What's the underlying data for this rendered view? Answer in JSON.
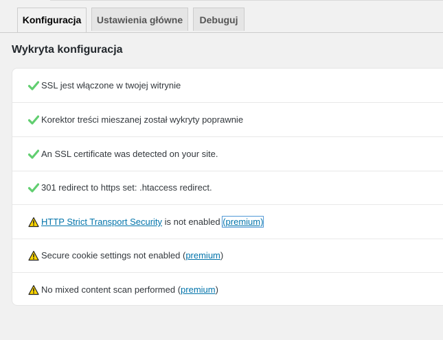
{
  "tabs": [
    {
      "label": "Konfiguracja",
      "active": true
    },
    {
      "label": "Ustawienia główne",
      "active": false
    },
    {
      "label": "Debuguj",
      "active": false
    }
  ],
  "title": "Wykryta konfiguracja",
  "colors": {
    "check": "#61ce70",
    "warning_fill": "#ffd700",
    "link": "#0073aa"
  },
  "items": [
    {
      "status": "ok",
      "text": "SSL jest włączone w twojej witrynie"
    },
    {
      "status": "ok",
      "text": "Korektor treści mieszanej został wykryty poprawnie"
    },
    {
      "status": "ok",
      "text": "An SSL certificate was detected on your site."
    },
    {
      "status": "ok",
      "text": "301 redirect to https set: .htaccess redirect."
    },
    {
      "status": "warning",
      "link": "HTTP Strict Transport Security",
      "text": " is not enabled ",
      "premium": "(premium)"
    },
    {
      "status": "warning",
      "text": "Secure cookie settings not enabled (",
      "premium": "premium",
      "suffix": ")"
    },
    {
      "status": "warning",
      "text": "No mixed content scan performed (",
      "premium": "premium",
      "suffix": ")"
    }
  ]
}
